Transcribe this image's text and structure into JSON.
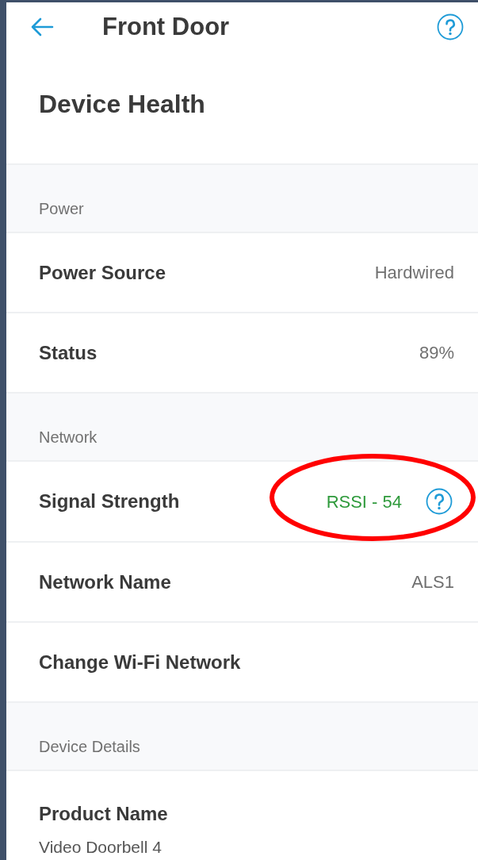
{
  "header": {
    "title": "Front Door"
  },
  "page_title": "Device Health",
  "sections": [
    {
      "title": "Power",
      "rows": [
        {
          "kind": "value",
          "label": "Power Source",
          "value": "Hardwired"
        },
        {
          "kind": "value",
          "label": "Status",
          "value": "89%"
        }
      ]
    },
    {
      "title": "Network",
      "rows": [
        {
          "kind": "signal",
          "label": "Signal Strength",
          "value": "RSSI - 54",
          "highlighted": true
        },
        {
          "kind": "value",
          "label": "Network Name",
          "value": "ALS1"
        },
        {
          "kind": "link",
          "label": "Change Wi-Fi Network"
        }
      ]
    },
    {
      "title": "Device Details",
      "rows": [
        {
          "kind": "detail",
          "label": "Product Name",
          "value": "Video Doorbell 4"
        }
      ]
    }
  ]
}
